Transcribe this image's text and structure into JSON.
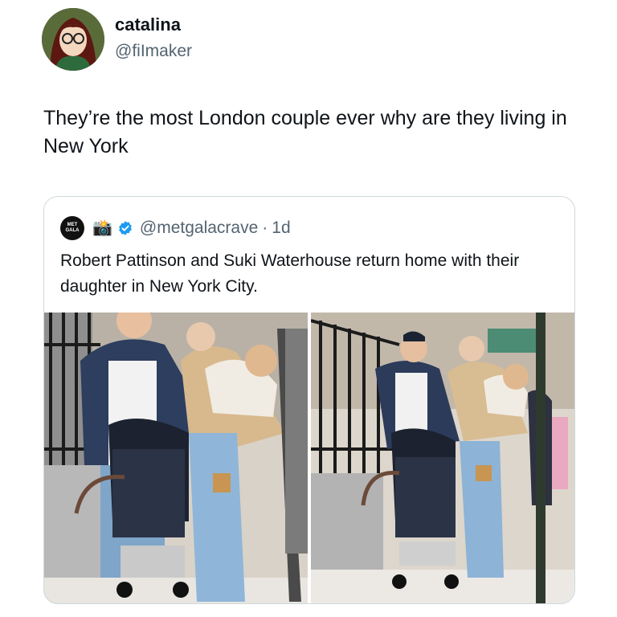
{
  "author": {
    "display_name": "catalina",
    "handle": "@fiImaker",
    "avatar_icon": "cartoon-girl-glasses-avatar"
  },
  "tweet": {
    "text": "They’re the most London couple ever why are they living in New York"
  },
  "quoted": {
    "avatar_label": "MET GALA",
    "avatar_icon": "metgala-logo-icon",
    "emoji": "📸",
    "verified_icon": "verified-badge-icon",
    "verified_color": "#1d9bf0",
    "handle": "@metgalacrave",
    "separator": "·",
    "time": "1d",
    "text": "Robert Pattinson and Suki Waterhouse return home with their daughter in New York City.",
    "photos": [
      {
        "icon": "street-photo-couple-with-stroller"
      },
      {
        "icon": "street-photo-couple-with-stroller"
      }
    ]
  }
}
